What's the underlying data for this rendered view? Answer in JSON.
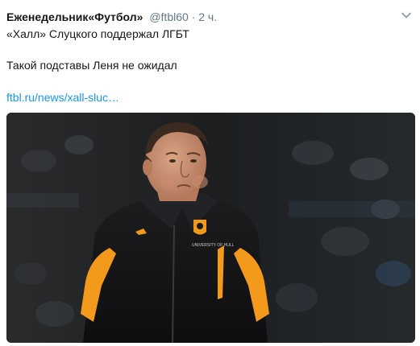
{
  "tweet": {
    "author_name": "Еженедельник«Футбол»",
    "handle": "@ftbl60",
    "separator": "·",
    "time": "2 ч.",
    "text_line1": "«Халл» Слуцкого поддержал ЛГБТ",
    "text_line2": "Такой подставы Леня не ожидал",
    "link": "ftbl.ru/news/xall-sluc…"
  },
  "icons": {
    "menu": "chevron-down-icon"
  },
  "media": {
    "badge_text": "UNIVERSITY OF HULL"
  },
  "colors": {
    "link": "#1b95e0",
    "secondary_text": "#657786",
    "jacket_orange": "#f39a1d"
  }
}
